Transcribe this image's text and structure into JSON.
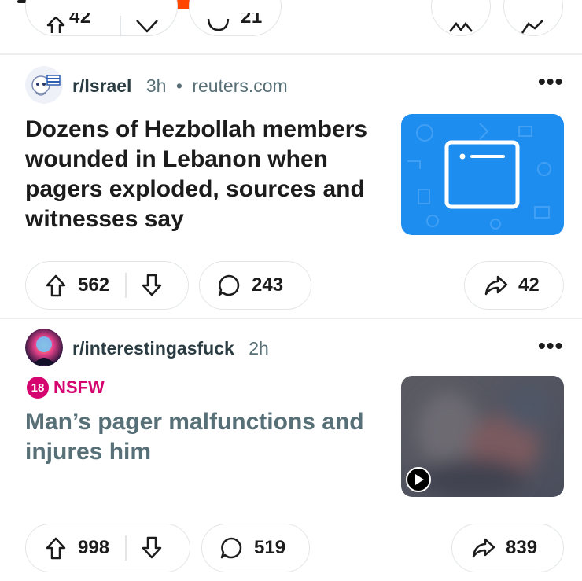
{
  "header": {
    "brand_color": "#ff4500",
    "online_color": "#0dd36b",
    "icons": [
      "menu-icon",
      "search-icon",
      "user-avatar-icon"
    ]
  },
  "previous_post": {
    "upvotes": "42",
    "comments": "21"
  },
  "posts": [
    {
      "subreddit": "r/Israel",
      "age": "3h",
      "separator": "•",
      "domain": "reuters.com",
      "title_lines": [
        "Dozens of Hezbollah members",
        "wounded in Lebanon when",
        "pagers exploded, sources and",
        "witnesses say"
      ],
      "thumbnail": "link-icon",
      "thumbnail_color": "#1e8df0",
      "upvotes": "562",
      "comments": "243",
      "shares": "42"
    },
    {
      "subreddit": "r/interestingasfuck",
      "age": "2h",
      "nsfw_badge": "18",
      "nsfw_label": "NSFW",
      "title_lines": [
        "Man’s pager malfunctions and",
        "injures him"
      ],
      "thumbnail": "video-play-icon",
      "upvotes": "998",
      "comments": "519",
      "shares": "839"
    }
  ],
  "colors": {
    "nsfw": "#d4056f",
    "meta_text": "#576f76",
    "border": "#e2e5e7"
  }
}
